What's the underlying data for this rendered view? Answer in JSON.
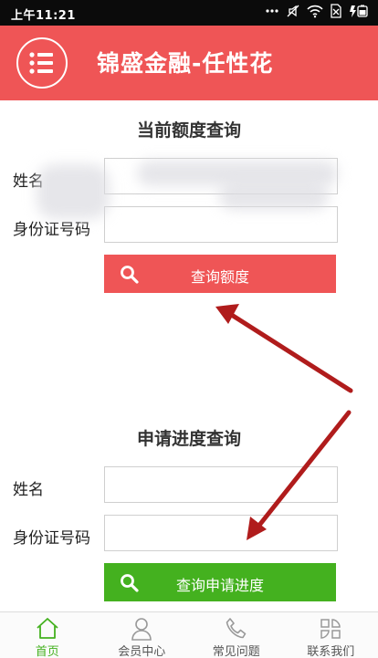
{
  "status_bar": {
    "time": "上午11:21"
  },
  "header": {
    "title": "锦盛金融-任性花"
  },
  "credit_query": {
    "title": "当前额度查询",
    "name_label": "姓名",
    "id_label": "身份证号码",
    "name_value": "",
    "id_value": "",
    "button_label": "查询额度"
  },
  "progress_query": {
    "title": "申请进度查询",
    "name_label": "姓名",
    "id_label": "身份证号码",
    "name_value": "",
    "id_value": "",
    "button_label": "查询申请进度"
  },
  "bottom_nav": [
    {
      "label": "首页",
      "icon": "home-icon",
      "active": true
    },
    {
      "label": "会员中心",
      "icon": "user-icon",
      "active": false
    },
    {
      "label": "常见问题",
      "icon": "phone-icon",
      "active": false
    },
    {
      "label": "联系我们",
      "icon": "contact-icon",
      "active": false
    }
  ],
  "colors": {
    "brand_red": "#ef5556",
    "brand_green": "#44b11f",
    "annotation_arrow": "#b01c1c"
  }
}
